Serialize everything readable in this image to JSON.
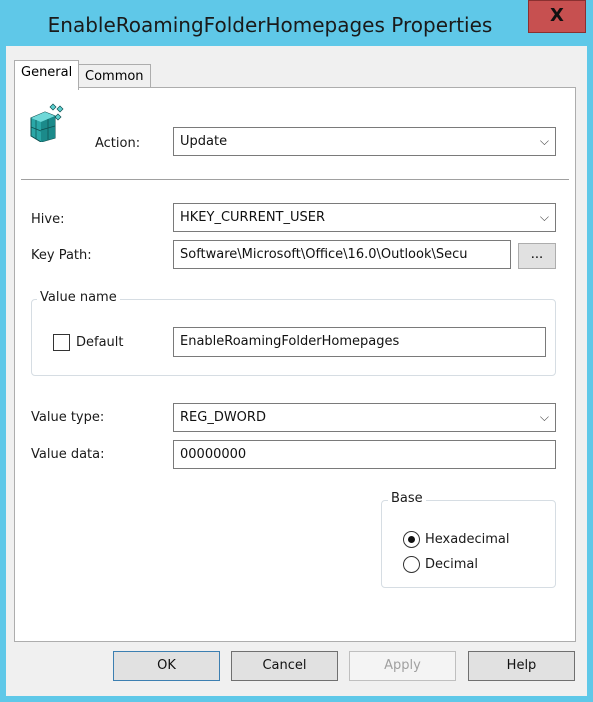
{
  "window": {
    "title": "EnableRoamingFolderHomepages Properties",
    "close_label": "X"
  },
  "tabs": [
    {
      "label": "General",
      "active": true
    },
    {
      "label": "Common",
      "active": false
    }
  ],
  "general": {
    "icon": "registry-cubes-icon",
    "action_label": "Action:",
    "action_value": "Update",
    "hive_label": "Hive:",
    "hive_value": "HKEY_CURRENT_USER",
    "key_path_label": "Key Path:",
    "key_path_value": "Software\\Microsoft\\Office\\16.0\\Outlook\\Secu",
    "browse_label": "...",
    "value_name_group": "Value name",
    "default_label": "Default",
    "default_checked": false,
    "value_name_value": "EnableRoamingFolderHomepages",
    "value_type_label": "Value type:",
    "value_type_value": "REG_DWORD",
    "value_data_label": "Value data:",
    "value_data_value": "00000000",
    "base_group": "Base",
    "base_options": [
      {
        "label": "Hexadecimal",
        "checked": true
      },
      {
        "label": "Decimal",
        "checked": false
      }
    ]
  },
  "buttons": {
    "ok": "OK",
    "cancel": "Cancel",
    "apply": "Apply",
    "help": "Help"
  },
  "dropdown_chevron": "⌵"
}
